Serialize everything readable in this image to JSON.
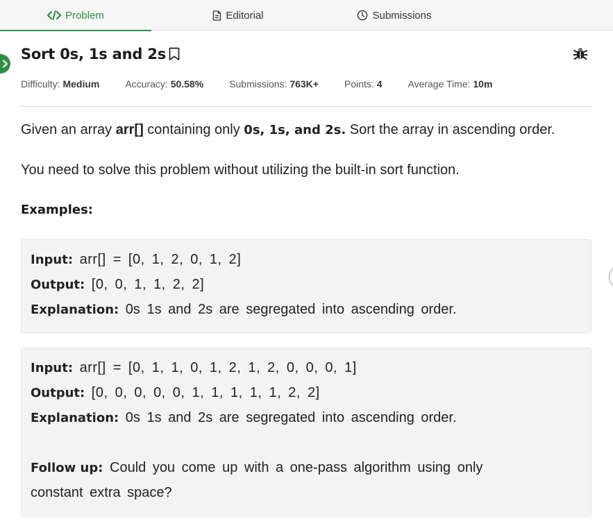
{
  "tabs": {
    "problem": "Problem",
    "editorial": "Editorial",
    "submissions": "Submissions"
  },
  "problem": {
    "title": "Sort 0s, 1s and 2s",
    "meta": [
      {
        "label": "Difficulty:",
        "value": "Medium"
      },
      {
        "label": "Accuracy:",
        "value": "50.58%"
      },
      {
        "label": "Submissions:",
        "value": "763K+"
      },
      {
        "label": "Points:",
        "value": "4"
      },
      {
        "label": "Average Time:",
        "value": "10m"
      }
    ],
    "desc": {
      "p1_a": "Given an array ",
      "p1_b": "arr[]",
      "p1_c": " containing only ",
      "p1_d": "0s, 1s, and 2s.",
      "p1_e": " Sort the array in ascending order.",
      "p2": "You need to solve this problem without utilizing the built-in sort function."
    },
    "examples_heading": "Examples:",
    "examples": [
      {
        "input_label": "Input:",
        "input": "arr[] = [0, 1, 2, 0, 1, 2]",
        "output_label": "Output:",
        "output": "[0, 0, 1, 1, 2, 2]",
        "explanation_label": "Explanation:",
        "explanation": "0s 1s and 2s are segregated into ascending order."
      },
      {
        "input_label": "Input:",
        "input": "arr[] = [0, 1, 1, 0, 1, 2, 1, 2, 0, 0, 0, 1]",
        "output_label": "Output:",
        "output": "[0, 0, 0, 0, 0, 1, 1, 1, 1, 1, 2, 2]",
        "explanation_label": "Explanation:",
        "explanation": "0s 1s and 2s are segregated into ascending order."
      }
    ],
    "follow_up_label": "Follow up:",
    "follow_up_1": "Could you come up with a one-pass algorithm using only",
    "follow_up_2": "constant extra space?"
  },
  "colors": {
    "accent": "#2f8d46",
    "box_bg": "#f3f3f3"
  },
  "icons": [
    "code-icon",
    "document-icon",
    "clock-icon",
    "bookmark-icon",
    "bug-icon",
    "chevron-right-icon"
  ]
}
